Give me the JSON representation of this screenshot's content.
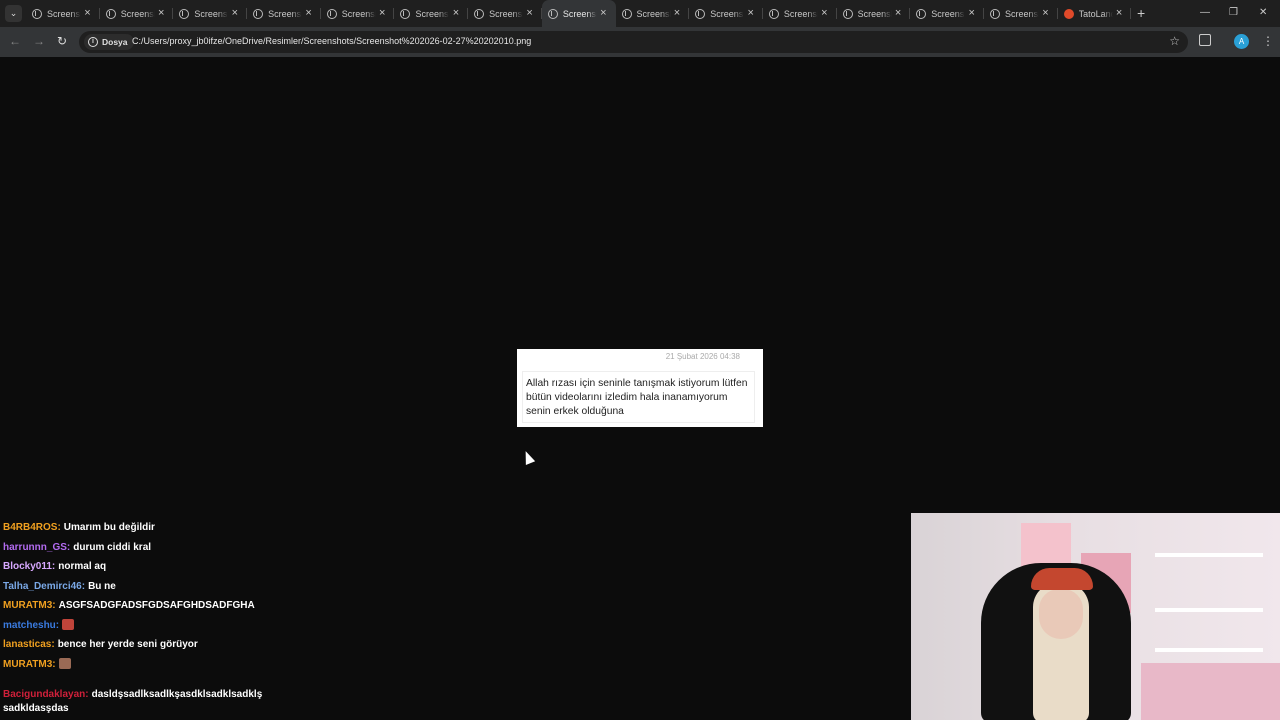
{
  "browser": {
    "tabs": [
      {
        "title": "Screenshot",
        "active": false,
        "favicon": "globe-icon"
      },
      {
        "title": "Screenshot",
        "active": false,
        "favicon": "globe-icon"
      },
      {
        "title": "Screenshot",
        "active": false,
        "favicon": "globe-icon"
      },
      {
        "title": "Screenshot",
        "active": false,
        "favicon": "globe-icon"
      },
      {
        "title": "Screenshot",
        "active": false,
        "favicon": "globe-icon"
      },
      {
        "title": "Screenshot",
        "active": false,
        "favicon": "globe-icon"
      },
      {
        "title": "Screenshot",
        "active": false,
        "favicon": "globe-icon"
      },
      {
        "title": "Screenshot",
        "active": true,
        "favicon": "globe-icon"
      },
      {
        "title": "Screenshot",
        "active": false,
        "favicon": "globe-icon"
      },
      {
        "title": "Screenshot",
        "active": false,
        "favicon": "globe-icon"
      },
      {
        "title": "Screenshot",
        "active": false,
        "favicon": "globe-icon"
      },
      {
        "title": "Screenshot",
        "active": false,
        "favicon": "globe-icon"
      },
      {
        "title": "Screenshot",
        "active": false,
        "favicon": "globe-icon"
      },
      {
        "title": "Screenshot",
        "active": false,
        "favicon": "globe-icon"
      },
      {
        "title": "TatoLand",
        "active": false,
        "favicon": "reddit-icon"
      }
    ],
    "address": {
      "chip_label": "Dosya",
      "url": "C:/Users/proxy_jb0ifze/OneDrive/Resimler/Screenshots/Screenshot%202026-02-27%20202010.png"
    },
    "profile_initial": "A"
  },
  "message": {
    "date": "21 Şubat 2026 04:38",
    "text": "Allah rızası için seninle tanışmak istiyorum lütfen bütün videolarını izledim hala inanamıyorum senin erkek olduğuna"
  },
  "chat": [
    {
      "user": "B4RB4ROS:",
      "color": "#f0a020",
      "text": "Umarım bu değildir"
    },
    {
      "user": "harrunnn_GS:",
      "color": "#b36bf0",
      "text": "durum ciddi kral"
    },
    {
      "user": "Blocky011:",
      "color": "#d7a8ff",
      "text": "normal aq"
    },
    {
      "user": "Talha_Demirci46:",
      "color": "#7aa8e6",
      "text": "Bu ne"
    },
    {
      "user": "MURATM3:",
      "color": "#f0a020",
      "text": "ASGFSADGFADSFGDSAFGHDSADFGHA"
    },
    {
      "user": "matcheshu:",
      "color": "#3a7be0",
      "text": "",
      "emote": "#c0443a"
    },
    {
      "user": "lanasticas:",
      "color": "#f0a020",
      "text": "bence her yerde seni görüyor"
    },
    {
      "user": "MURATM3:",
      "color": "#f0a020",
      "text": "",
      "emote": "#9a6a55"
    },
    {
      "user": "Bacigundaklayan:",
      "color": "#d0203a",
      "text": "dasldşsadlksadlkşasdklsadklsadklş sadkldasşdas"
    }
  ]
}
